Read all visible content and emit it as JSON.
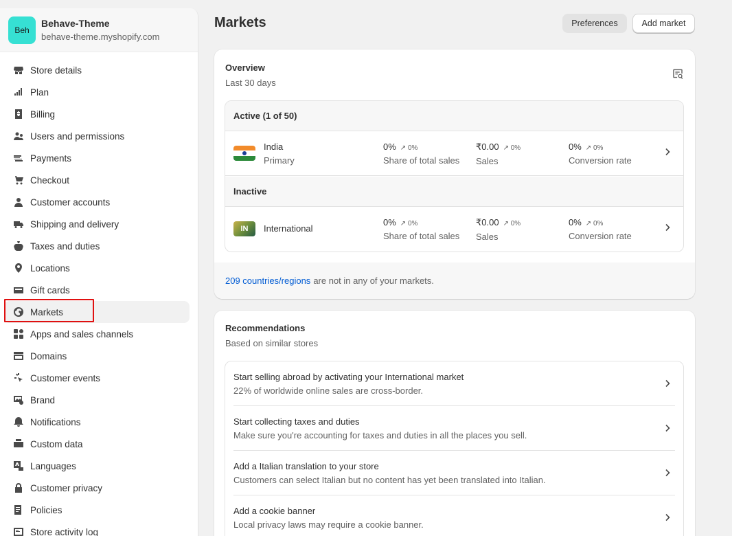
{
  "store": {
    "initials": "Beh",
    "name": "Behave-Theme",
    "domain": "behave-theme.myshopify.com"
  },
  "nav": [
    {
      "label": "Store details",
      "icon": "store-icon"
    },
    {
      "label": "Plan",
      "icon": "plan-icon"
    },
    {
      "label": "Billing",
      "icon": "billing-icon"
    },
    {
      "label": "Users and permissions",
      "icon": "users-icon"
    },
    {
      "label": "Payments",
      "icon": "payments-icon"
    },
    {
      "label": "Checkout",
      "icon": "cart-icon"
    },
    {
      "label": "Customer accounts",
      "icon": "person-icon"
    },
    {
      "label": "Shipping and delivery",
      "icon": "truck-icon"
    },
    {
      "label": "Taxes and duties",
      "icon": "tax-icon"
    },
    {
      "label": "Locations",
      "icon": "location-icon"
    },
    {
      "label": "Gift cards",
      "icon": "gift-card-icon"
    },
    {
      "label": "Markets",
      "icon": "globe-icon",
      "active": true
    },
    {
      "label": "Apps and sales channels",
      "icon": "apps-icon"
    },
    {
      "label": "Domains",
      "icon": "domains-icon"
    },
    {
      "label": "Customer events",
      "icon": "cursor-icon"
    },
    {
      "label": "Brand",
      "icon": "brand-icon"
    },
    {
      "label": "Notifications",
      "icon": "bell-icon"
    },
    {
      "label": "Custom data",
      "icon": "custom-data-icon"
    },
    {
      "label": "Languages",
      "icon": "language-icon"
    },
    {
      "label": "Customer privacy",
      "icon": "lock-icon"
    },
    {
      "label": "Policies",
      "icon": "policies-icon"
    },
    {
      "label": "Store activity log",
      "icon": "activity-log-icon"
    }
  ],
  "page": {
    "title": "Markets",
    "preferences": "Preferences",
    "add_market": "Add market"
  },
  "overview": {
    "title": "Overview",
    "subtitle": "Last 30 days",
    "active_header": "Active (1 of 50)",
    "inactive_header": "Inactive",
    "markets": [
      {
        "name": "India",
        "sub": "Primary",
        "flag_text": "",
        "share": "0%",
        "share_delta": "0%",
        "share_label": "Share of total sales",
        "sales": "₹0.00",
        "sales_delta": "0%",
        "sales_label": "Sales",
        "conv": "0%",
        "conv_delta": "0%",
        "conv_label": "Conversion rate"
      },
      {
        "name": "International",
        "sub": "",
        "flag_text": "IN",
        "share": "0%",
        "share_delta": "0%",
        "share_label": "Share of total sales",
        "sales": "₹0.00",
        "sales_delta": "0%",
        "sales_label": "Sales",
        "conv": "0%",
        "conv_delta": "0%",
        "conv_label": "Conversion rate"
      }
    ],
    "footer_link": "209 countries/regions",
    "footer_text": "are not in any of your markets."
  },
  "recommendations": {
    "title": "Recommendations",
    "subtitle": "Based on similar stores",
    "items": [
      {
        "title": "Start selling abroad by activating your International market",
        "desc": "22% of worldwide online sales are cross-border."
      },
      {
        "title": "Start collecting taxes and duties",
        "desc": "Make sure you're accounting for taxes and duties in all the places you sell."
      },
      {
        "title": "Add a Italian translation to your store",
        "desc": "Customers can select Italian but no content has yet been translated into Italian."
      },
      {
        "title": "Add a cookie banner",
        "desc": "Local privacy laws may require a cookie banner."
      }
    ]
  }
}
